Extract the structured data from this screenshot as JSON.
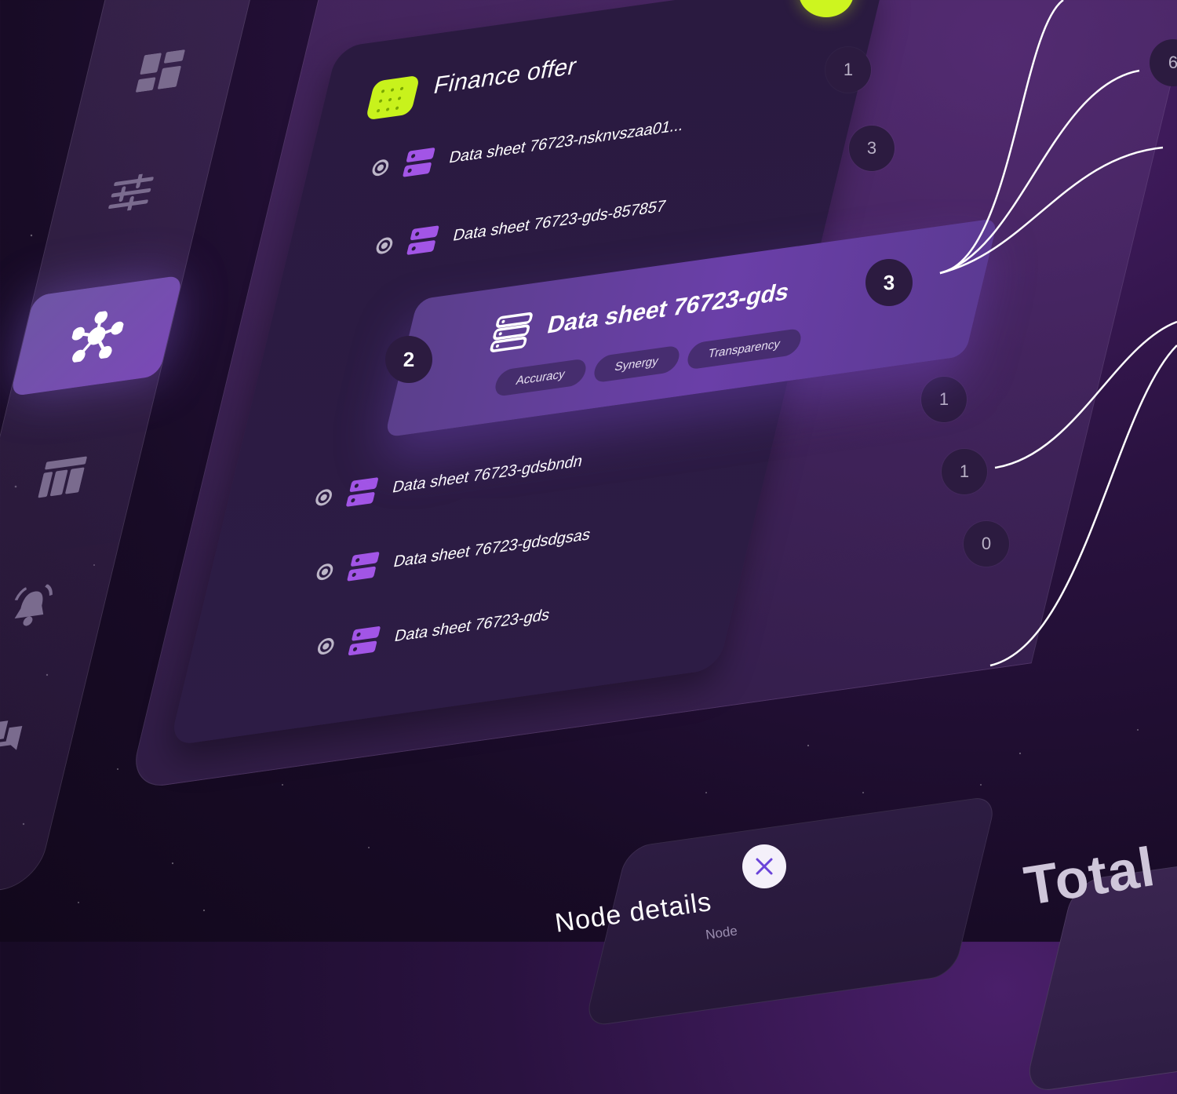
{
  "sidebar": {
    "items": [
      {
        "icon": "dashboard-icon"
      },
      {
        "icon": "sliders-icon"
      },
      {
        "icon": "network-icon",
        "active": true
      },
      {
        "icon": "table-icon"
      },
      {
        "icon": "bell-icon"
      },
      {
        "icon": "chat-icon"
      },
      {
        "icon": "account-icon"
      }
    ]
  },
  "finance": {
    "title": "Finance offer",
    "rows_top": [
      {
        "label": "Data sheet 76723-nsknvszaa01...",
        "count": "1"
      },
      {
        "label": "Data sheet 76723-gds-857857",
        "count": "3"
      }
    ],
    "node": {
      "title": "Data sheet 76723-gds",
      "left_badge": "2",
      "right_badge": "3",
      "tags": [
        "Accuracy",
        "Synergy",
        "Transparency"
      ]
    },
    "rows_bottom": [
      {
        "label": "Data sheet 76723-gdsbndn",
        "count": "1"
      },
      {
        "label": "Data sheet 76723-gdsdgsas",
        "count": "1"
      },
      {
        "label": "Data sheet 76723-gds",
        "count": "0"
      }
    ]
  },
  "edge_chip": "6",
  "details": {
    "title": "Node details",
    "sub": "Node",
    "close_icon": "close-icon"
  },
  "total": {
    "label": "Total"
  },
  "colors": {
    "accent": "#c8f21c",
    "purple": "#a255e6",
    "node": "#6a3fa8"
  }
}
